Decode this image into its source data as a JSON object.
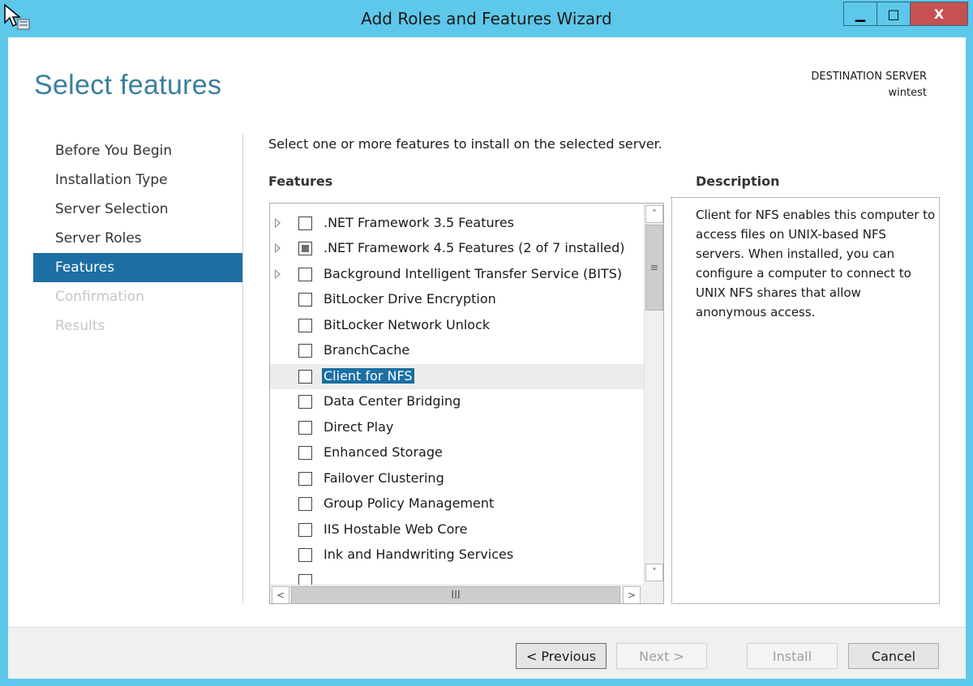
{
  "window": {
    "title": "Add Roles and Features Wizard",
    "minimize_glyph": "▁",
    "maximize_glyph": "□",
    "close_glyph": "X"
  },
  "page": {
    "title": "Select features",
    "destination_label": "DESTINATION SERVER",
    "destination_server": "wintest",
    "instruction": "Select one or more features to install on the selected server."
  },
  "nav": {
    "items": [
      {
        "label": "Before You Begin",
        "state": "normal"
      },
      {
        "label": "Installation Type",
        "state": "normal"
      },
      {
        "label": "Server Selection",
        "state": "normal"
      },
      {
        "label": "Server Roles",
        "state": "normal"
      },
      {
        "label": "Features",
        "state": "active"
      },
      {
        "label": "Confirmation",
        "state": "disabled"
      },
      {
        "label": "Results",
        "state": "disabled"
      }
    ]
  },
  "features": {
    "header": "Features",
    "items": [
      {
        "label": ".NET Framework 3.5 Features",
        "expandable": true,
        "check": "unchecked"
      },
      {
        "label": ".NET Framework 4.5 Features (2 of 7 installed)",
        "expandable": true,
        "check": "partial"
      },
      {
        "label": "Background Intelligent Transfer Service (BITS)",
        "expandable": true,
        "check": "unchecked"
      },
      {
        "label": "BitLocker Drive Encryption",
        "expandable": false,
        "check": "unchecked"
      },
      {
        "label": "BitLocker Network Unlock",
        "expandable": false,
        "check": "unchecked"
      },
      {
        "label": "BranchCache",
        "expandable": false,
        "check": "unchecked"
      },
      {
        "label": "Client for NFS",
        "expandable": false,
        "check": "unchecked",
        "selected": true
      },
      {
        "label": "Data Center Bridging",
        "expandable": false,
        "check": "unchecked"
      },
      {
        "label": "Direct Play",
        "expandable": false,
        "check": "unchecked"
      },
      {
        "label": "Enhanced Storage",
        "expandable": false,
        "check": "unchecked"
      },
      {
        "label": "Failover Clustering",
        "expandable": false,
        "check": "unchecked"
      },
      {
        "label": "Group Policy Management",
        "expandable": false,
        "check": "unchecked"
      },
      {
        "label": "IIS Hostable Web Core",
        "expandable": false,
        "check": "unchecked"
      },
      {
        "label": "Ink and Handwriting Services",
        "expandable": false,
        "check": "unchecked"
      },
      {
        "label": "",
        "expandable": false,
        "check": "unchecked"
      }
    ]
  },
  "description": {
    "header": "Description",
    "text": "Client for NFS enables this computer to access files on UNIX-based NFS servers. When installed, you can configure a computer to connect to UNIX NFS shares that allow anonymous access."
  },
  "scrollbar": {
    "up_glyph": "˄",
    "down_glyph": "˅",
    "left_glyph": "<",
    "right_glyph": ">",
    "v_grip": "≡",
    "h_grip": "III"
  },
  "footer": {
    "previous_label": "< Previous",
    "next_label": "Next >",
    "install_label": "Install",
    "cancel_label": "Cancel"
  },
  "colors": {
    "titlebar": "#5ec8ea",
    "accent": "#1c6ea4",
    "page_title": "#3a7fa0",
    "close_button": "#c75050"
  }
}
